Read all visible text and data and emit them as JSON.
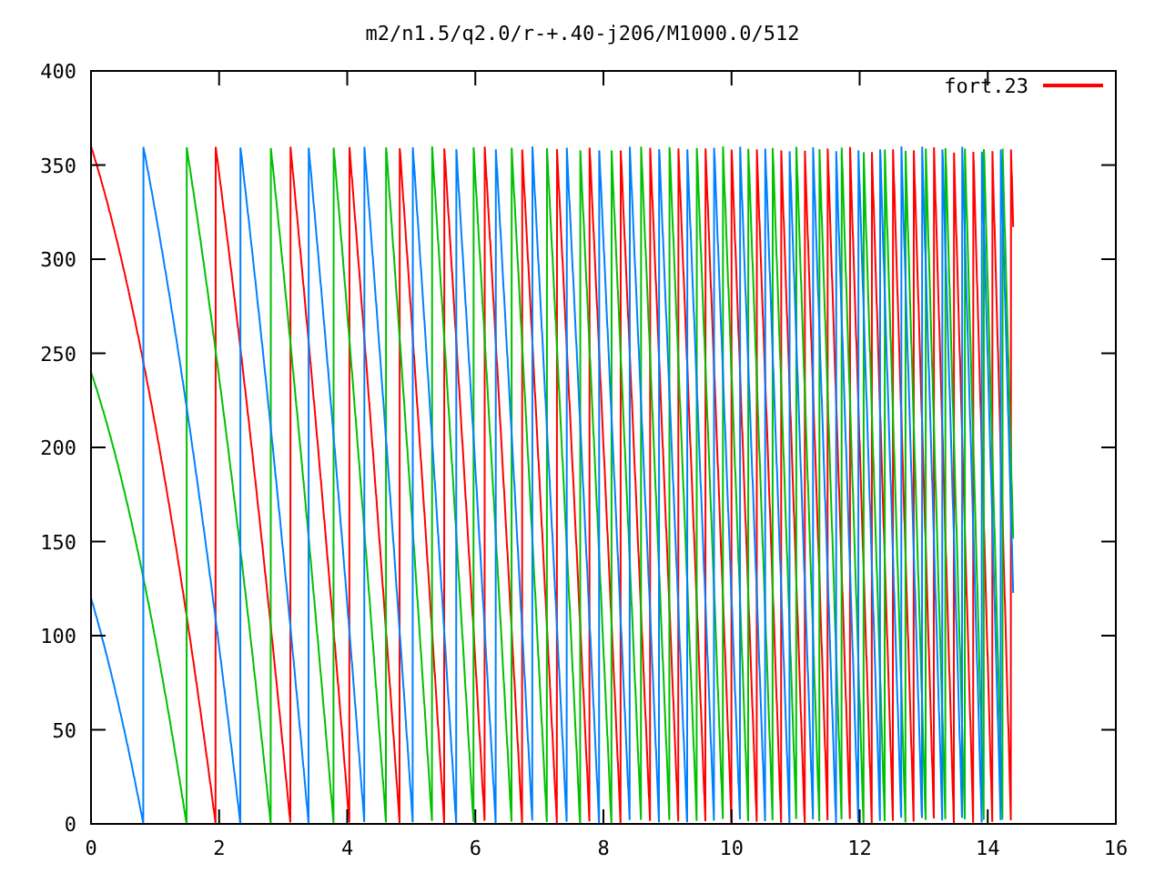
{
  "plot": {
    "title": "m2/n1.5/q2.0/r-+.40-j206/M1000.0/512",
    "y_ticks": [
      "400",
      "350",
      "300",
      "250",
      "200",
      "150",
      "100",
      "50",
      "0"
    ],
    "x_ticks": [
      "0",
      "2",
      "4",
      "6",
      "8",
      "10",
      "12",
      "14",
      "16"
    ],
    "legend": {
      "label": "fort.23",
      "color": "#ff0000"
    }
  }
}
